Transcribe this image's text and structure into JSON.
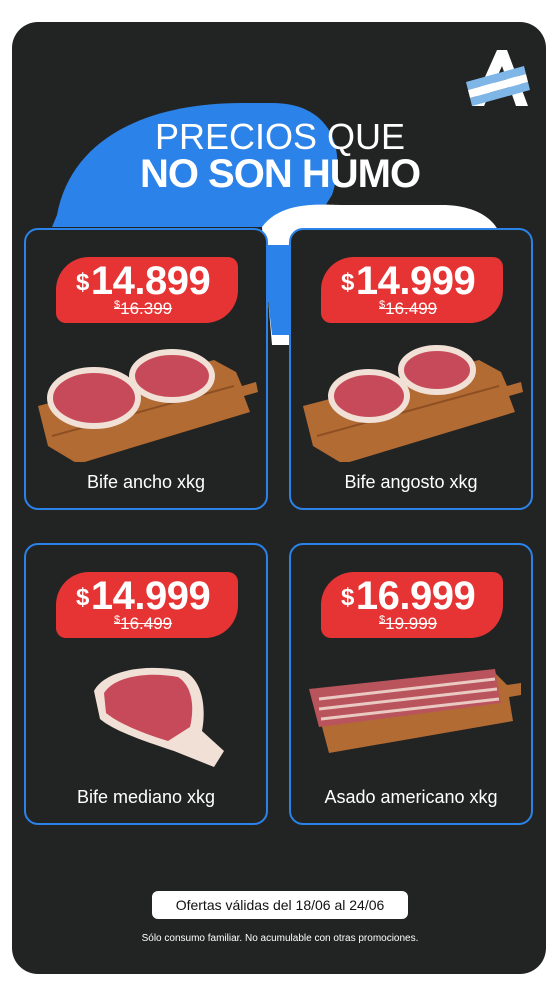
{
  "header": {
    "title_line1": "PRECIOS QUE",
    "title_line2": "NO SON HUMO"
  },
  "logo": {
    "icon": "a-flag-logo-icon",
    "color": "#2b82e8"
  },
  "products": [
    {
      "name": "Bife ancho xkg",
      "currency": "$",
      "price": "14.899",
      "old_price": "16.399",
      "image": "two-steaks-on-board"
    },
    {
      "name": "Bife angosto xkg",
      "currency": "$",
      "price": "14.999",
      "old_price": "16.499",
      "image": "two-steaks-on-board"
    },
    {
      "name": "Bife mediano xkg",
      "currency": "$",
      "price": "14.999",
      "old_price": "16.499",
      "image": "single-steak"
    },
    {
      "name": "Asado americano xkg",
      "currency": "$",
      "price": "16.999",
      "old_price": "19.999",
      "image": "ribs-on-board"
    }
  ],
  "footer": {
    "validity": "Ofertas válidas del 18/06 al 24/06",
    "disclaimer": "Sólo consumo familiar. No acumulable con otras promociones."
  },
  "colors": {
    "background": "#222424",
    "accent_blue": "#2b82e8",
    "price_red": "#e63434"
  }
}
